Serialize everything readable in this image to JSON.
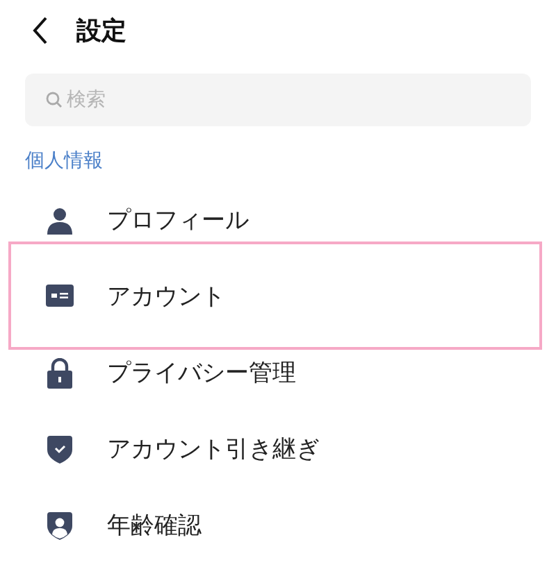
{
  "header": {
    "title": "設定"
  },
  "search": {
    "placeholder": "検索"
  },
  "section": {
    "title": "個人情報"
  },
  "items": [
    {
      "label": "プロフィール",
      "kind": "person",
      "highlighted": false
    },
    {
      "label": "アカウント",
      "kind": "card",
      "highlighted": true
    },
    {
      "label": "プライバシー管理",
      "kind": "lock",
      "highlighted": false
    },
    {
      "label": "アカウント引き継ぎ",
      "kind": "shield-check",
      "highlighted": false
    },
    {
      "label": "年齢確認",
      "kind": "shield-person",
      "highlighted": false
    }
  ]
}
